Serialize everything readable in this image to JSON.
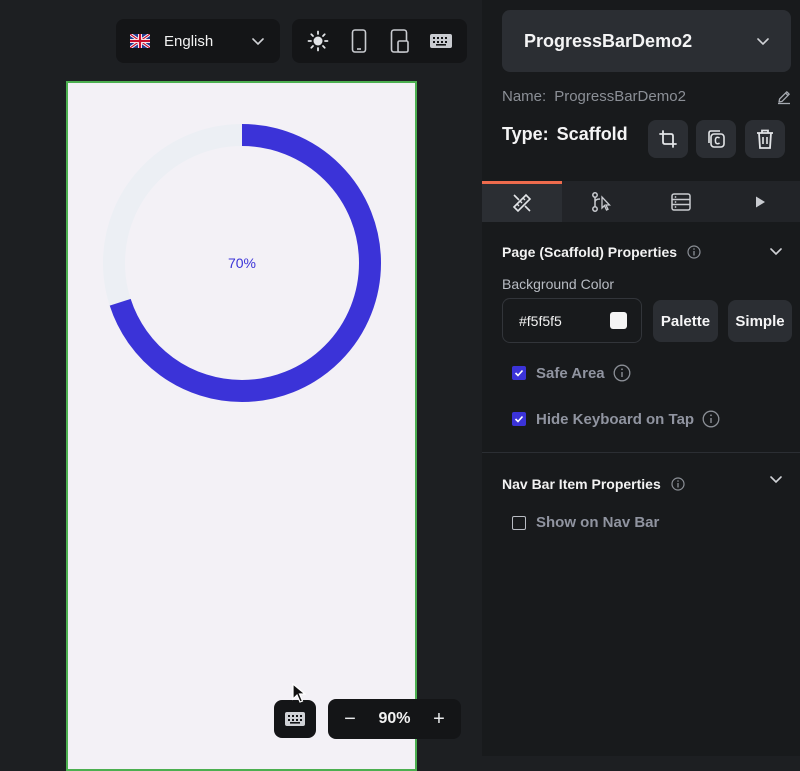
{
  "toolbar": {
    "language": "English",
    "device_icons": [
      "sun-icon",
      "phone-icon",
      "tablet-icon",
      "keyboard-icon"
    ]
  },
  "canvas": {
    "background": "#f3f1f6",
    "border_color": "#4caf50",
    "progress": {
      "label": "70%",
      "value": 0.7,
      "fill_color": "#3b33d8",
      "track_color": "#eceff4"
    }
  },
  "zoom": {
    "minus": "−",
    "value": "90%",
    "plus": "+"
  },
  "panel": {
    "widget_title": "ProgressBarDemo2",
    "name_label": "Name:",
    "name_value": "ProgressBarDemo2",
    "type_label": "Type:",
    "type_value": "Scaffold",
    "tabs": [
      "properties",
      "actions",
      "backend",
      "run"
    ],
    "active_tab": "properties",
    "page_section": {
      "title": "Page (Scaffold) Properties",
      "bg_label": "Background Color",
      "bg_value": "#f5f5f5",
      "bg_display": "#f5f5f5",
      "palette_label": "Palette",
      "simple_label": "Simple",
      "safe_area_label": "Safe Area",
      "safe_area_checked": true,
      "hide_keyboard_label": "Hide Keyboard on Tap",
      "hide_keyboard_checked": true
    },
    "nav_section": {
      "title": "Nav Bar Item Properties",
      "show_label": "Show on Nav Bar",
      "show_checked": false
    },
    "colors": {
      "accent": "#3b33d8",
      "tab_indicator": "#ee6b4d"
    }
  }
}
